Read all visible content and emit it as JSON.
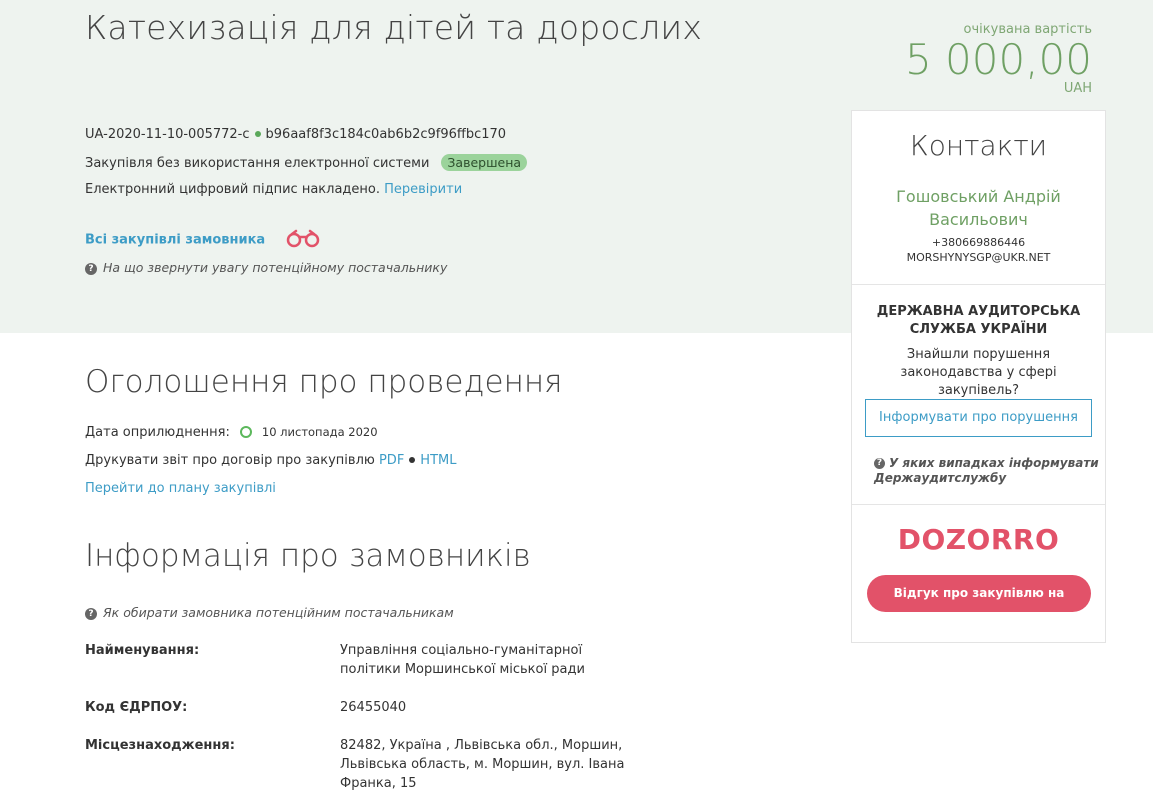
{
  "header": {
    "title": "Катехизація для дітей та дорослих",
    "value_label": "очікувана вартість",
    "value_amount": "5 000,00",
    "value_currency": "UAH",
    "tender_id": "UA-2020-11-10-005772-c",
    "hash": "b96aaf8f3c184c0ab6b2c9f96ffbc170",
    "procurement_type": "Закупівля без використання електронної системи",
    "status": "Завершена",
    "signature_text": "Електронний цифровий підпис накладено.",
    "verify_link": "Перевірити",
    "all_purchases_link": "Всі закупівлі замовника",
    "attention_hint": "На що звернути увагу потенційному постачальнику"
  },
  "announcement": {
    "title": "Оголошення про проведення",
    "published_label": "Дата оприлюднення:",
    "published_date": "10 листопада 2020",
    "print_label": "Друкувати звіт про договір про закупівлю",
    "pdf_link": "PDF",
    "html_link": "HTML",
    "plan_link": "Перейти до плану закупівлі"
  },
  "customers": {
    "title": "Інформація про замовників",
    "hint": "Як обирати замовника потенційним постачальникам",
    "rows": [
      {
        "label": "Найменування:",
        "value": "Управління соціально-гуманітарної політики Моршинської міської ради"
      },
      {
        "label": "Код ЄДРПОУ:",
        "value": "26455040"
      },
      {
        "label": "Місцезнаходження:",
        "value": "82482, Україна , Львівська обл., Моршин, Львівська область, м. Моршин, вул. Івана Франка, 15"
      }
    ]
  },
  "panel": {
    "contacts_title": "Контакти",
    "contact_name": "Гошовський Андрій Васильович",
    "contact_phone": "+380669886446",
    "contact_email": "MORSHYNYSGP@UKR.NET",
    "audit_title": "ДЕРЖАВНА АУДИТОРСЬКА СЛУЖБА УКРАЇНИ",
    "audit_text": "Знайшли порушення законодавства у сфері закупівель?",
    "inform_button": "Інформувати про порушення",
    "audit_hint": "У яких випадках інформувати Держаудитслужбу",
    "dozorro_logo": "DOZORRO",
    "dozorro_button": "Відгук про закупівлю на Дозорро"
  },
  "colors": {
    "hero_bg": "#eef3ef",
    "accent_green": "#6fa064",
    "link_blue": "#3d9cc6",
    "dozorro_red": "#e25269"
  }
}
